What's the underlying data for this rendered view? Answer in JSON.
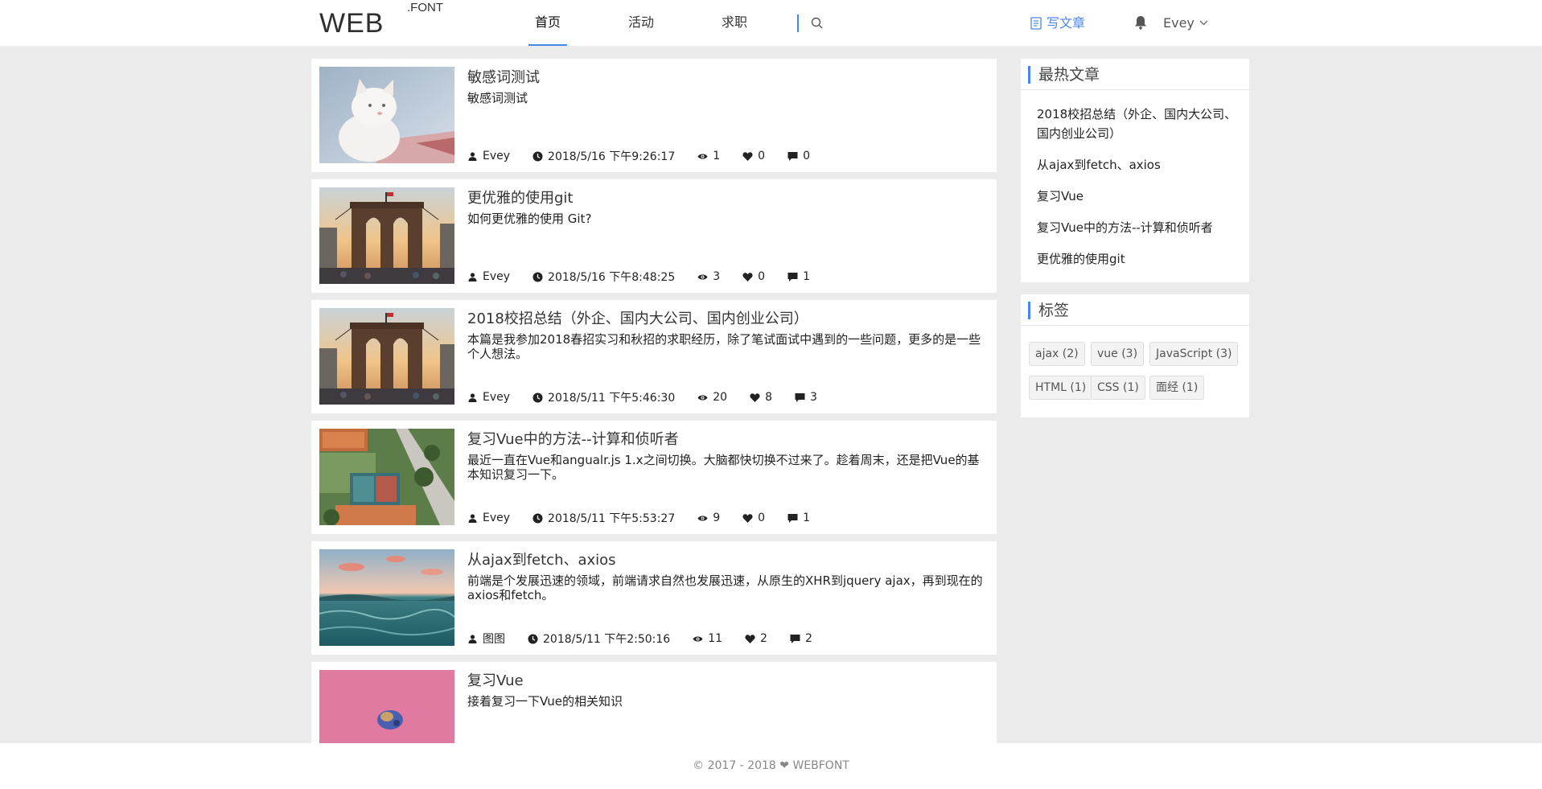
{
  "brand": {
    "logo_main": "WEB",
    "logo_sup": ".FONT"
  },
  "nav": {
    "home": "首页",
    "events": "活动",
    "jobs": "求职"
  },
  "header": {
    "write_label": "写文章",
    "username": "Evey"
  },
  "posts": [
    {
      "title": "敏感词测试",
      "excerpt": "敏感词测试",
      "author": "Evey",
      "date": "2018/5/16 下午9:26:17",
      "views": "1",
      "likes": "0",
      "comments": "0"
    },
    {
      "title": "更优雅的使用git",
      "excerpt": "如何更优雅的使用 Git?",
      "author": "Evey",
      "date": "2018/5/16 下午8:48:25",
      "views": "3",
      "likes": "0",
      "comments": "1"
    },
    {
      "title": "2018校招总结（外企、国内大公司、国内创业公司）",
      "excerpt": "本篇是我参加2018春招实习和秋招的求职经历，除了笔试面试中遇到的一些问题，更多的是一些个人想法。",
      "author": "Evey",
      "date": "2018/5/11 下午5:46:30",
      "views": "20",
      "likes": "8",
      "comments": "3"
    },
    {
      "title": "复习Vue中的方法--计算和侦听者",
      "excerpt": "最近一直在Vue和angualr.js 1.x之间切换。大脑都快切换不过来了。趁着周末，还是把Vue的基本知识复习一下。",
      "author": "Evey",
      "date": "2018/5/11 下午5:53:27",
      "views": "9",
      "likes": "0",
      "comments": "1"
    },
    {
      "title": "从ajax到fetch、axios",
      "excerpt": "前端是个发展迅速的领域，前端请求自然也发展迅速，从原生的XHR到jquery ajax，再到现在的axios和fetch。",
      "author": "图图",
      "date": "2018/5/11 下午2:50:16",
      "views": "11",
      "likes": "2",
      "comments": "2"
    },
    {
      "title": "复习Vue",
      "excerpt": "接着复习一下Vue的相关知识"
    }
  ],
  "sidebar": {
    "hot_title": "最热文章",
    "hot_items": [
      "2018校招总结（外企、国内大公司、国内创业公司）",
      "从ajax到fetch、axios",
      "复习Vue",
      "复习Vue中的方法--计算和侦听者",
      "更优雅的使用git"
    ],
    "tags_title": "标签",
    "tags": [
      "ajax (2)",
      "vue (3)",
      "JavaScript (3)",
      "HTML (1)",
      "CSS (1)",
      "面经 (1)"
    ]
  },
  "footer": {
    "text": "© 2017 - 2018 ❤ WEBFONT"
  },
  "colors": {
    "accent": "#4a86e8",
    "background": "#ebebeb"
  }
}
